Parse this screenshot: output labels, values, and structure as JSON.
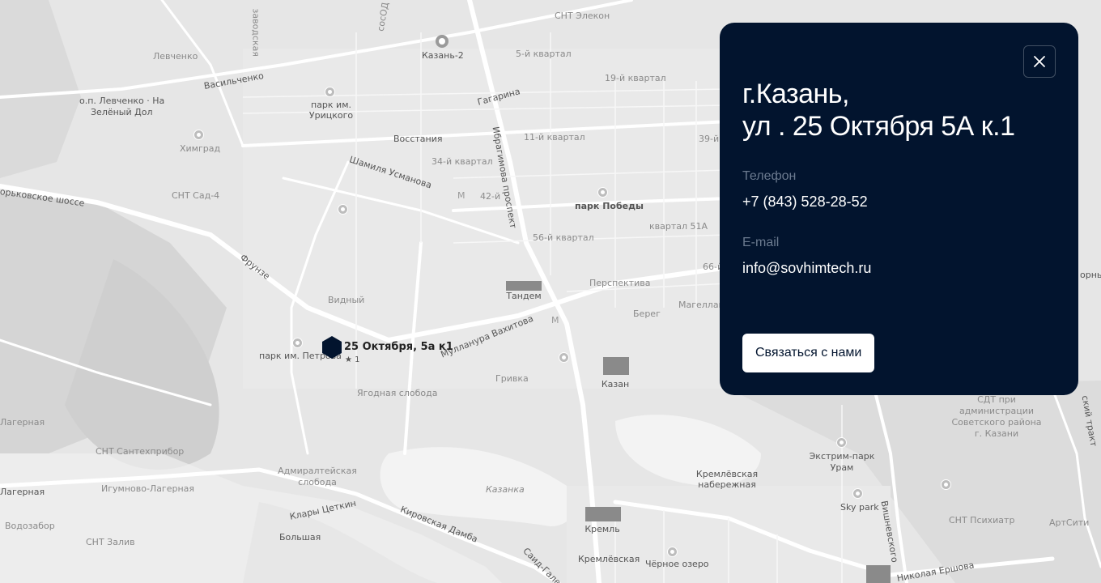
{
  "map": {
    "labels": {
      "zavodskaya": "заводская",
      "sosnovaya": "сосОД",
      "snt_elekon": "СНТ Элекон",
      "levchenko": "Левченко",
      "kazan2": "Казань-2",
      "kvartal5": "5-й квартал",
      "vasilchenko": "Васильченко",
      "gagarina": "Гагарина",
      "kvartal19": "19-й квартал",
      "op_levchenko": "о.п. Левченко · На",
      "zeleny_dol": "Зелёный Дол",
      "park_urickogo_1": "парк им.",
      "park_urickogo_2": "Урицкого",
      "vosstaniya": "Восстания",
      "ibragimova": "Ибрагимова проспект",
      "kvartal11": "11-й квартал",
      "kvartal39": "39-й",
      "himgrad": "Химград",
      "shamilya": "Шамиля Усманова",
      "kvartal34": "34-й квартал",
      "gorkovskoe": "орьковское шоссе",
      "snt_sad4": "СНТ Сад-4",
      "kvartal42": "42-й",
      "park_pobedy": "парк Победы",
      "kvartal51a": "квартал 51А",
      "kvartal56": "56-й квартал",
      "frunze": "Фрунзе",
      "kvartal66": "66-й",
      "gorny": "орны",
      "perspektiva": "Перспектива",
      "tandem": "Тандем",
      "vidny": "Видный",
      "bereg": "Берег",
      "magellan": "Магеллан",
      "mullanura": "Мулланура Вахитова",
      "park_petrova": "парк им. Петрова",
      "grivka": "Гривка",
      "kazan": "Казан",
      "yagodnaya": "Ягодная слобода",
      "lagernaya1": "Лагерная",
      "sdt_1": "СДТ при",
      "sdt_2": "администрации",
      "sdt_3": "Советского района",
      "sdt_4": "г. Казани",
      "trakt": "ский тракт",
      "snt_santeh": "СНТ Сантехприбор",
      "extreme_1": "Экстрим-парк",
      "extreme_2": "Урам",
      "admiral_1": "Адмиралтейская",
      "admiral_2": "слобода",
      "kreml_nab_1": "Кремлёвская",
      "kreml_nab_2": "набережная",
      "lagernaya2": "Лагерная",
      "igumnovo": "Игумново-Лагерная",
      "kazanka": "Казанка",
      "skypark": "Sky park",
      "vishnevskogo": "Вишневского",
      "klary": "Клары Цеткин",
      "kirovskaya": "Кировская Дамба",
      "snt_psih": "СНТ Психиатр",
      "artsiti": "АртСити",
      "vodozabor": "Водозабор",
      "snt_zaliv": "СНТ Залив",
      "kreml": "Кремль",
      "bolshaya": "Большая",
      "said_gal": "Саид-Галее",
      "kremlevskaya": "Кремлёвская",
      "chernoe": "Чёрное озеро",
      "ershova": "Николая Ершова"
    },
    "marker": {
      "label": "25 Октября, 5а к1",
      "rating": "★ 1"
    }
  },
  "panel": {
    "title_line1": "г.Казань,",
    "title_line2": "ул . 25 Октября 5А к.1",
    "phone_label": "Телефон",
    "phone_value": "+7 (843) 528-28-52",
    "email_label": "E-mail",
    "email_value": "info@sovhimtech.ru",
    "contact_button": "Связаться с нами",
    "close_icon": "close-icon"
  },
  "colors": {
    "panel_bg": "#02142e",
    "marker": "#02142e",
    "map_bg": "#e6e6e6",
    "road": "#ffffff"
  }
}
